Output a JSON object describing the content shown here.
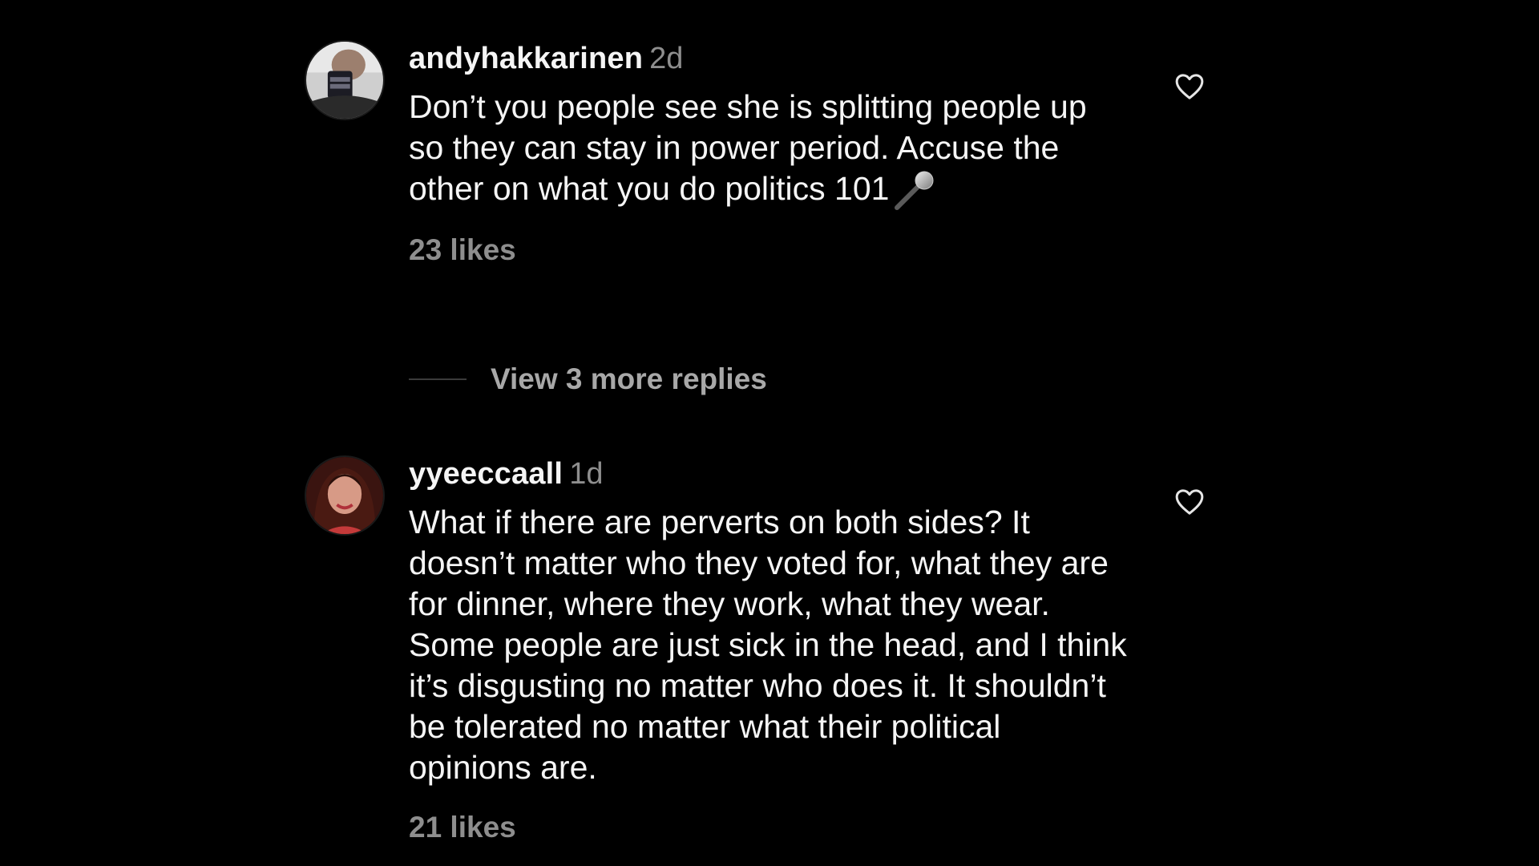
{
  "comments": [
    {
      "username": "andyhakkarinen",
      "time": "2d",
      "text": "Don’t you people see she is splitting people up so they can stay in power period. Accuse the other on what you do politics 101",
      "emoji": "microphone-icon",
      "likes": "23 likes"
    },
    {
      "username": "yyeeccaall",
      "time": "1d",
      "text": "What if there are perverts on both sides? It doesn’t matter who they voted for, what they are for dinner, where they work, what they wear. Some people are just sick in the head, and I think it’s disgusting no matter who does it. It shouldn’t be tolerated no matter what their political opinions are.",
      "likes": "21 likes"
    }
  ],
  "view_replies": "View 3 more replies",
  "colors": {
    "background": "#000000",
    "text": "#f5f5f5",
    "muted": "#8e8e8e",
    "replies": "#a8a8a8"
  }
}
